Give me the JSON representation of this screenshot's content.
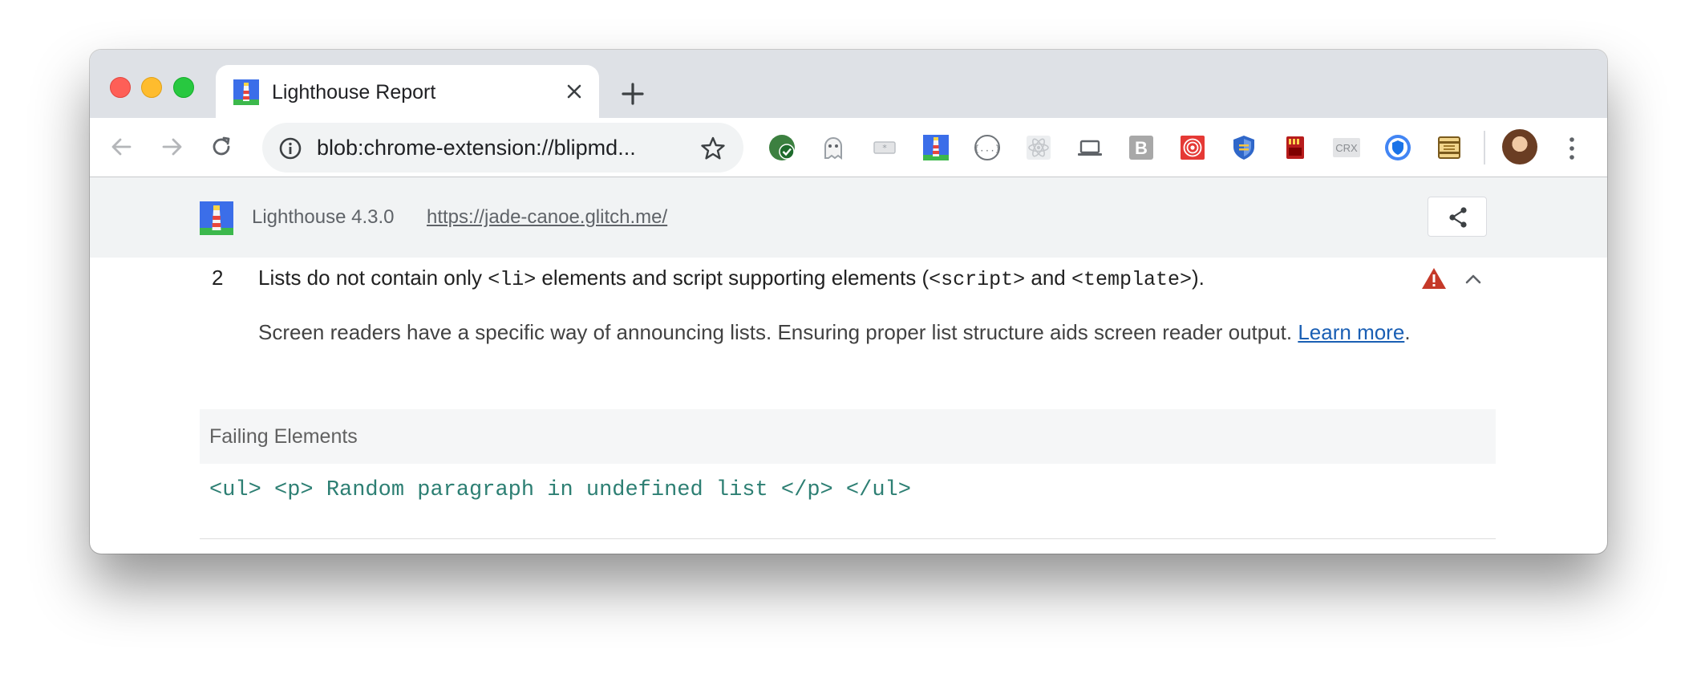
{
  "browser": {
    "tab_title": "Lighthouse Report",
    "omnibox_url": "blob:chrome-extension://blipmd...",
    "extensions": [
      {
        "icon": "green-check-extension-icon"
      },
      {
        "icon": "ghost-extension-icon"
      },
      {
        "icon": "asterisk-extension-icon"
      },
      {
        "icon": "lighthouse-extension-icon"
      },
      {
        "icon": "json-braces-extension-icon"
      },
      {
        "icon": "react-extension-icon"
      },
      {
        "icon": "laptop-extension-icon"
      },
      {
        "icon": "b-extension-icon",
        "letter": "B"
      },
      {
        "icon": "target-extension-icon"
      },
      {
        "icon": "shield-extension-icon"
      },
      {
        "icon": "sd-card-extension-icon"
      },
      {
        "icon": "crx-extension-icon",
        "letter": "CRX"
      },
      {
        "icon": "blue-shield-extension-icon"
      },
      {
        "icon": "scroll-extension-icon"
      }
    ]
  },
  "lighthouse": {
    "version": "Lighthouse 4.3.0",
    "url": "https://jade-canoe.glitch.me/"
  },
  "audit": {
    "index": "2",
    "title_parts": {
      "p1": "Lists do not contain only ",
      "code1": "<li>",
      "p2": " elements and script supporting elements (",
      "code2": "<script>",
      "p3": " and ",
      "code3": "<template>",
      "p4": ")."
    },
    "description": "Screen readers have a specific way of announcing lists. Ensuring proper list structure aids screen reader output. ",
    "learn_more": "Learn more",
    "period": ".",
    "failing_header": "Failing Elements",
    "failing_node": "<ul> <p> Random paragraph in undefined list </p> </ul>"
  },
  "colors": {
    "tabstrip": "#dee1e6",
    "header_bg": "#f1f3f4",
    "link": "#1a5fb4",
    "node_text": "#2d7f73",
    "warning": "#c53929"
  }
}
